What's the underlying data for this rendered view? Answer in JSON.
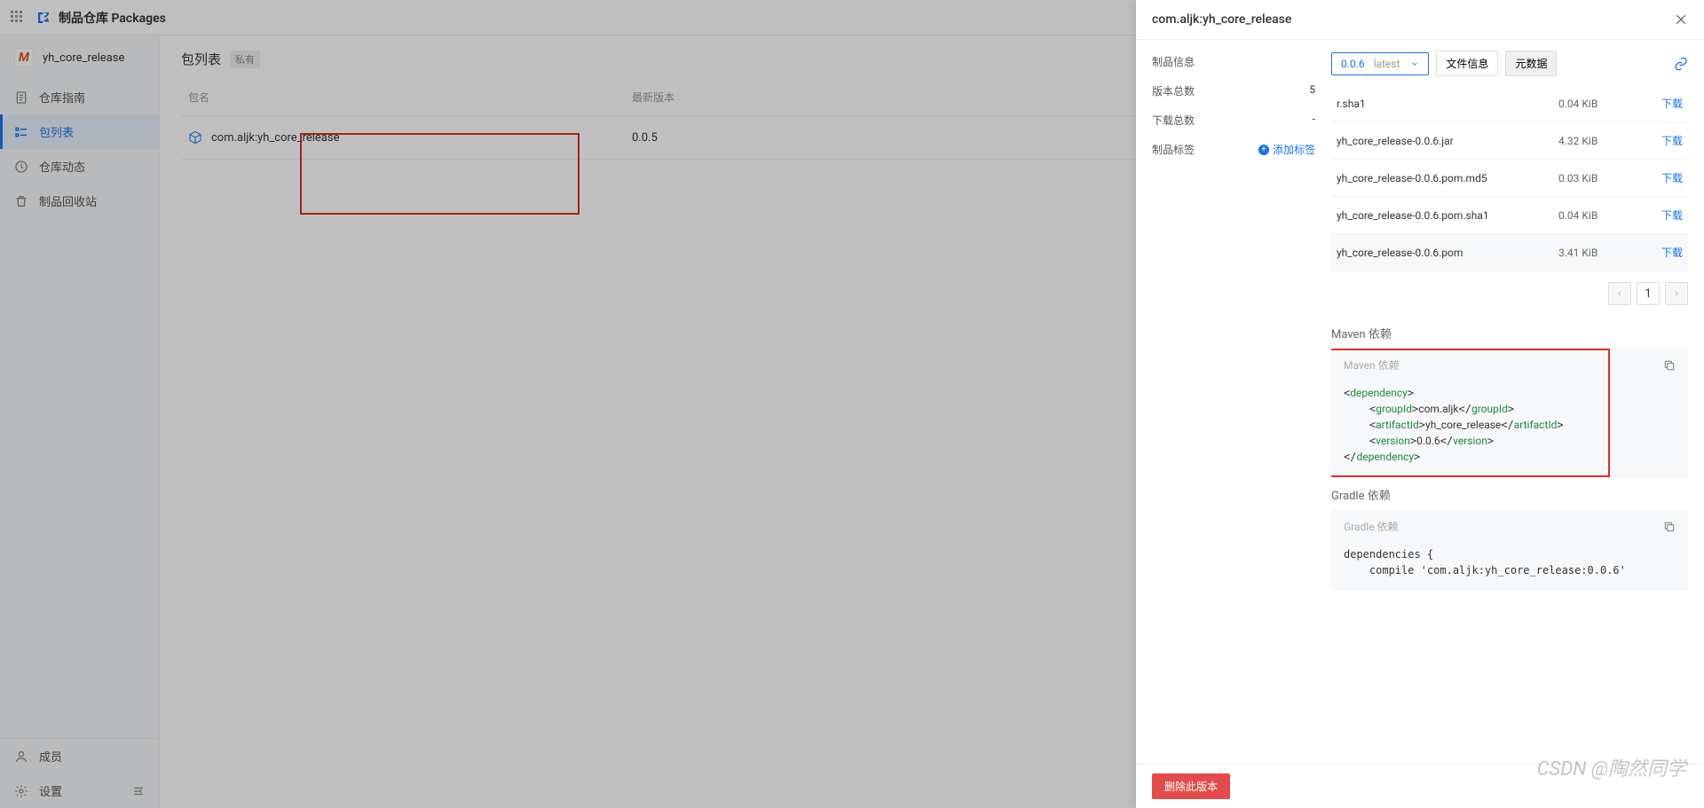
{
  "topbar": {
    "title": "制品仓库 Packages"
  },
  "repo": {
    "badge": "M",
    "name": "yh_core_release"
  },
  "nav": {
    "guide": "仓库指南",
    "packages": "包列表",
    "activity": "仓库动态",
    "recycle": "制品回收站",
    "members": "成员",
    "settings": "设置"
  },
  "main": {
    "title": "包列表",
    "private": "私有",
    "col_name": "包名",
    "col_ver": "最新版本",
    "row": {
      "name": "com.aljk:yh_core_release",
      "ver": "0.0.5"
    }
  },
  "panel": {
    "title": "com.aljk:yh_core_release",
    "info": {
      "k1": "制品信息",
      "k2": "版本总数",
      "v2": "5",
      "k3": "下载总数",
      "v3": "-",
      "k4": "制品标签",
      "add": "添加标签"
    },
    "version": {
      "num": "0.0.6",
      "latest": "latest"
    },
    "tabs": {
      "file": "文件信息",
      "meta": "元数据"
    },
    "files": [
      {
        "name": "r.sha1",
        "partial_top": true,
        "size": "0.04 KiB",
        "dl": "下载"
      },
      {
        "name": "yh_core_release-0.0.6.jar",
        "size": "4.32 KiB",
        "dl": "下载"
      },
      {
        "name": "yh_core_release-0.0.6.pom.md5",
        "size": "0.03 KiB",
        "dl": "下载"
      },
      {
        "name": "yh_core_release-0.0.6.pom.sha1",
        "size": "0.04 KiB",
        "dl": "下载"
      },
      {
        "name": "yh_core_release-0.0.6.pom",
        "size": "3.41 KiB",
        "dl": "下载",
        "hover": true
      }
    ],
    "page": "1",
    "maven": {
      "title": "Maven 依赖",
      "head": "Maven 依赖",
      "dep": "dependency",
      "gid_k": "groupId",
      "gid_v": "com.aljk",
      "aid_k": "artifactId",
      "aid_v": "yh_core_release",
      "ver_k": "version",
      "ver_v": "0.0.6"
    },
    "gradle": {
      "title": "Gradle 依赖",
      "head": "Gradle 依赖",
      "line1": "dependencies {",
      "line2": "    compile 'com.aljk:yh_core_release:0.0.6'"
    },
    "delete": "删除此版本"
  },
  "watermark": "CSDN @陶然同学"
}
